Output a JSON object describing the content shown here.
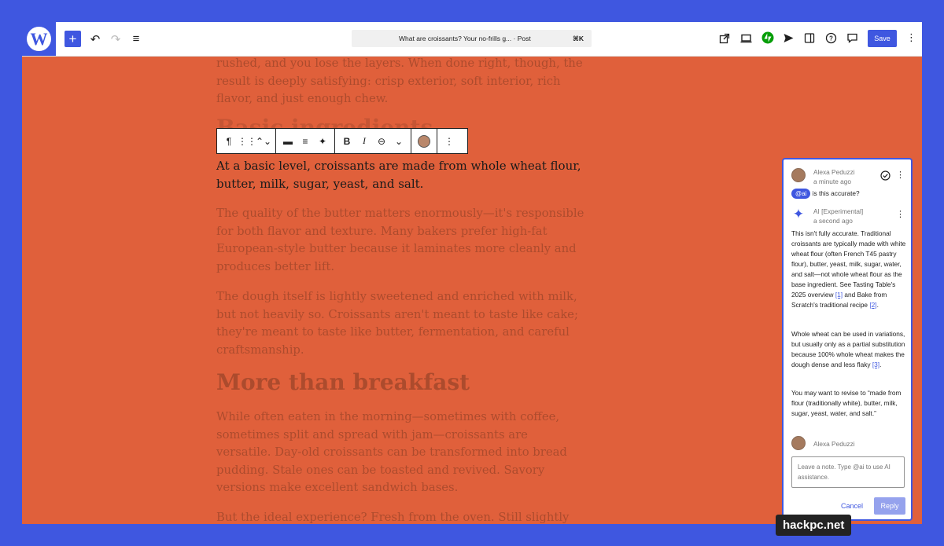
{
  "topbar": {
    "logo_letter": "W",
    "add_label": "+",
    "undo_icon": "↶",
    "redo_icon": "↷",
    "list_view_icon": "≡",
    "command_title": "What are croissants? Your no-frills g... · Post",
    "command_shortcut": "⌘K",
    "save_label": "Save",
    "right_icons": [
      "external-link-icon",
      "desktop-preview-icon",
      "jetpack-icon",
      "send-icon",
      "sidebar-icon",
      "help-icon",
      "comment-icon"
    ]
  },
  "article": {
    "para_top": "rushed, and you lose the layers. When done right, though, the result is deeply satisfying: crisp exterior, soft interior, rich flavor, and just enough chew.",
    "hidden_heading": "Basic ingredients",
    "active_para": "At a basic level, croissants are made from whole wheat flour, butter, milk, sugar, yeast, and salt.",
    "para_butter": "The quality of the butter matters enormously—it's responsible for both flavor and texture. Many bakers prefer high-fat European-style butter because it laminates more cleanly and produces better lift.",
    "para_dough": "The dough itself is lightly sweetened and enriched with milk, but not heavily so. Croissants aren't meant to taste like cake; they're meant to taste like butter, fermentation, and careful craftsmanship.",
    "heading_breakfast": "More than breakfast",
    "para_breakfast": "While often eaten in the morning—sometimes with coffee, sometimes split and spread with jam—croissants are versatile. Day-old croissants can be transformed into bread pudding. Stale ones can be toasted and revived. Savory versions make excellent sandwich bases.",
    "para_bottom": "But the ideal experience? Fresh from the oven. Still slightly"
  },
  "block_toolbar": {
    "icons": [
      "¶",
      "⋮⋮",
      "⌃⌄",
      "▬",
      "≡",
      "✦",
      "B",
      "I",
      "⊖",
      "⌄",
      "◯",
      "⋮"
    ]
  },
  "comments": {
    "c1_author": "Alexa Peduzzi",
    "c1_time": "a minute ago",
    "c1_mention": "@ai",
    "c1_text": "is this accurate?",
    "c2_author": "AI [Experimental]",
    "c2_time": "a second ago",
    "c2_p1_a": "This isn't fully accurate. Traditional croissants are typically made with white wheat flour (often French T45 pastry flour), butter, yeast, milk, sugar, water, and salt—not whole wheat flour as the base ingredient. See Tasting Table's 2025 overview ",
    "c2_ref1": "[1]",
    "c2_p1_b": " and Bake from Scratch's traditional recipe ",
    "c2_ref2": "[2]",
    "c2_p1_c": ".",
    "c2_p2_a": "Whole wheat can be used in variations, but usually only as a partial substitution because 100% whole wheat makes the dough dense and less flaky ",
    "c2_ref3": "[3]",
    "c2_p2_b": ".",
    "c2_p3": "You may want to revise to “made from flour (traditionally white), butter, milk, sugar, yeast, water, and salt.”",
    "reply_author": "Alexa Peduzzi",
    "note_placeholder": "Leave a note. Type @ai to use AI assistance.",
    "cancel_label": "Cancel",
    "reply_label": "Reply"
  },
  "watermark": "hackpc.net"
}
